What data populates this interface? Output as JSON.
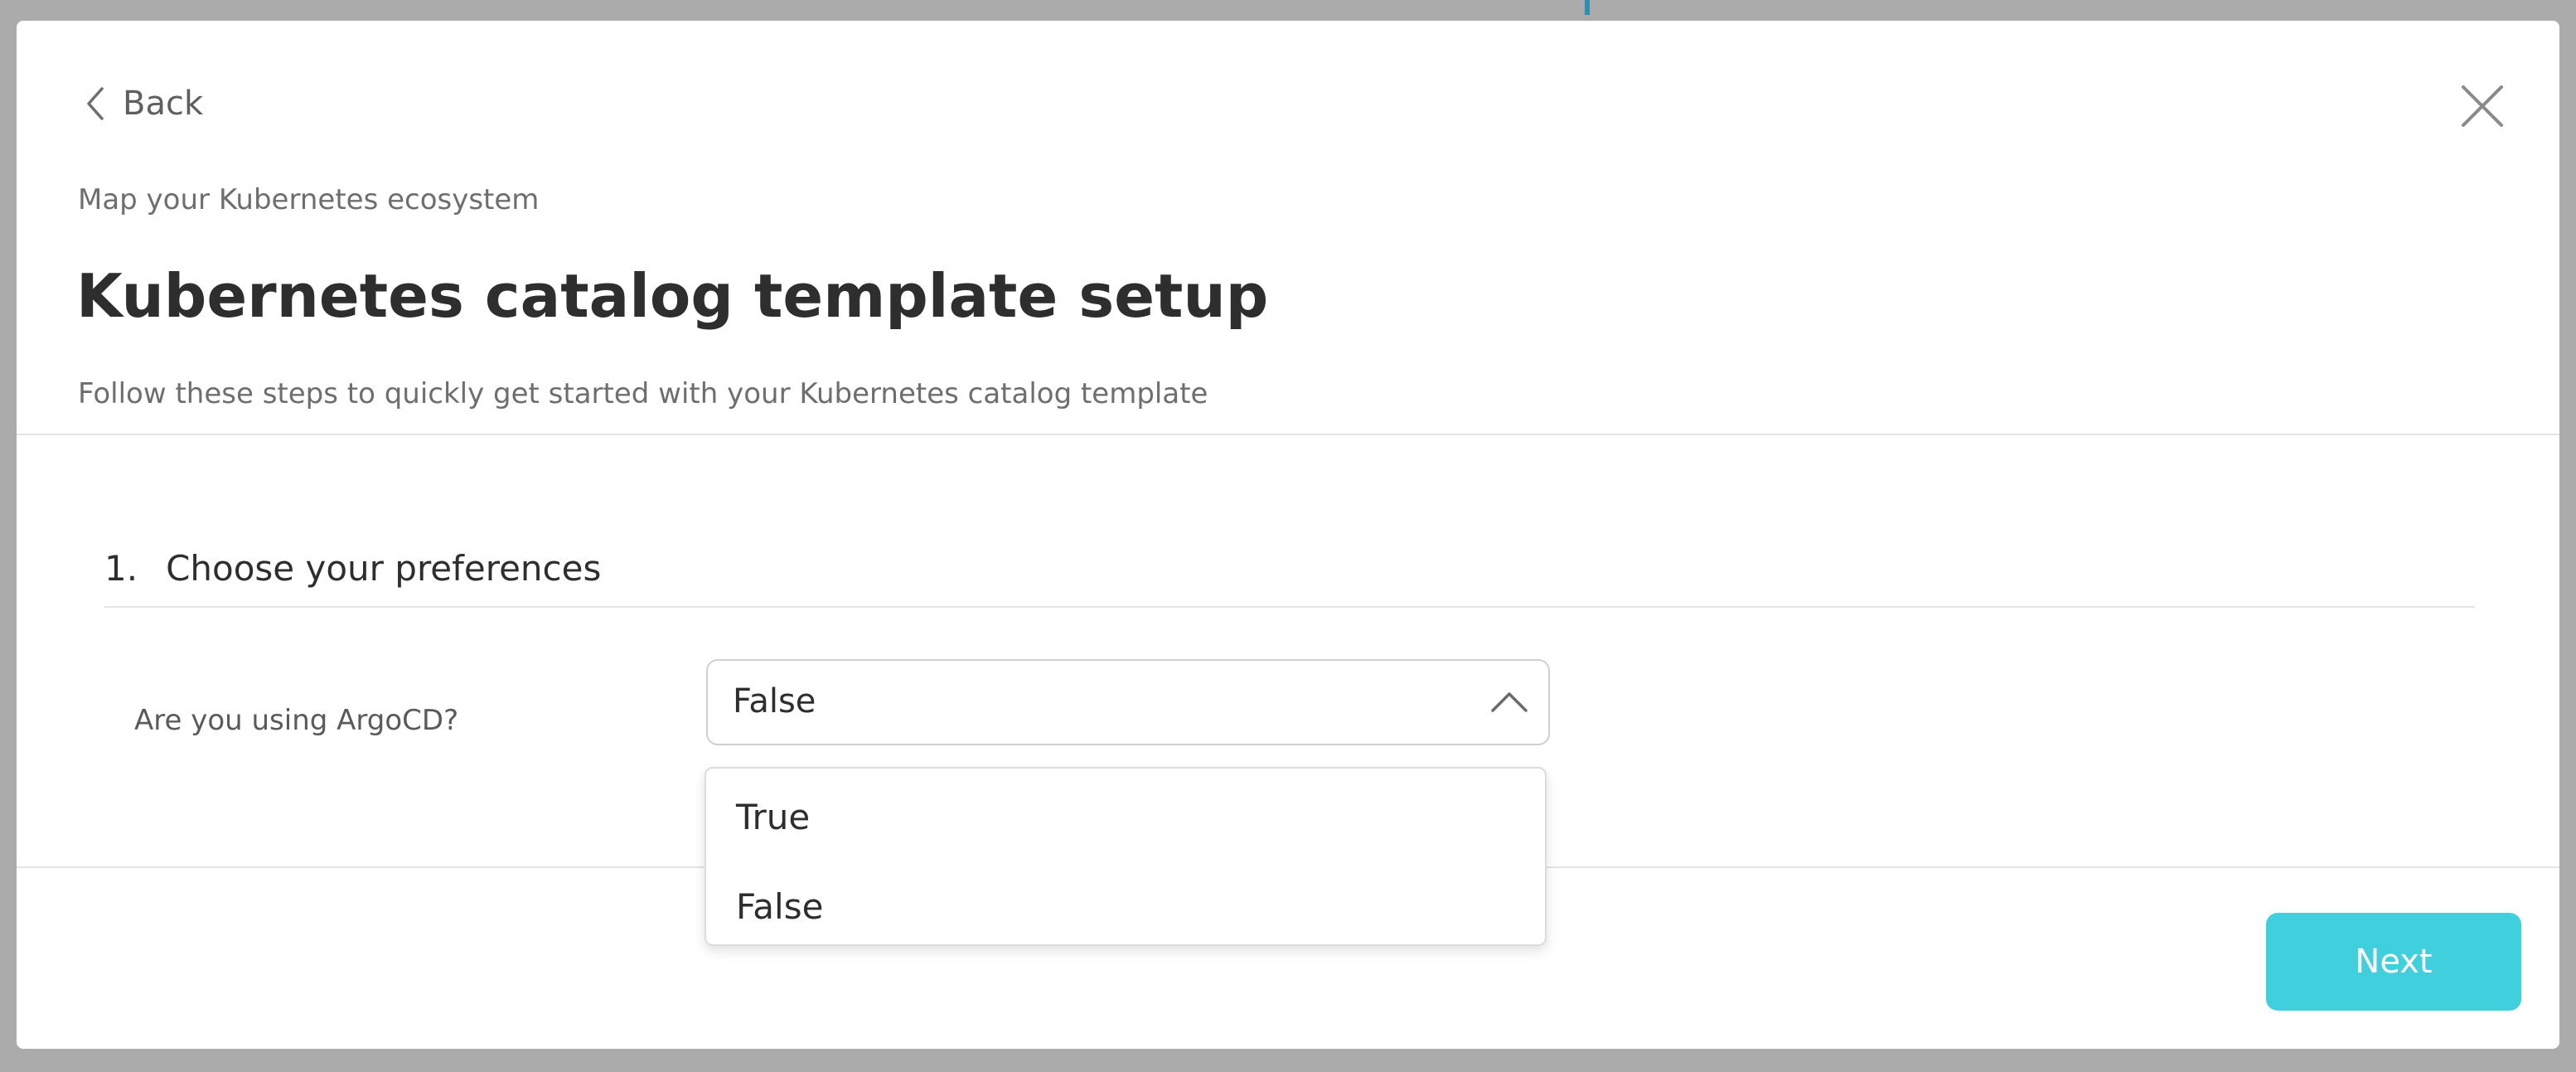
{
  "header": {
    "back_label": "Back",
    "eyebrow": "Map your Kubernetes ecosystem",
    "title": "Kubernetes catalog template setup",
    "subtitle": "Follow these steps to quickly get started with your Kubernetes catalog template"
  },
  "step": {
    "number": "1.",
    "title": "Choose your preferences"
  },
  "field": {
    "label": "Are you using ArgoCD?",
    "selected_value": "False",
    "state": "open",
    "options": [
      "True",
      "False"
    ]
  },
  "footer": {
    "next_label": "Next"
  },
  "icons": {
    "back": "chevron-left-icon",
    "close": "close-icon",
    "select": "chevron-up-icon"
  },
  "colors": {
    "accent": "#40d0dd",
    "backdrop": "#ababab"
  }
}
